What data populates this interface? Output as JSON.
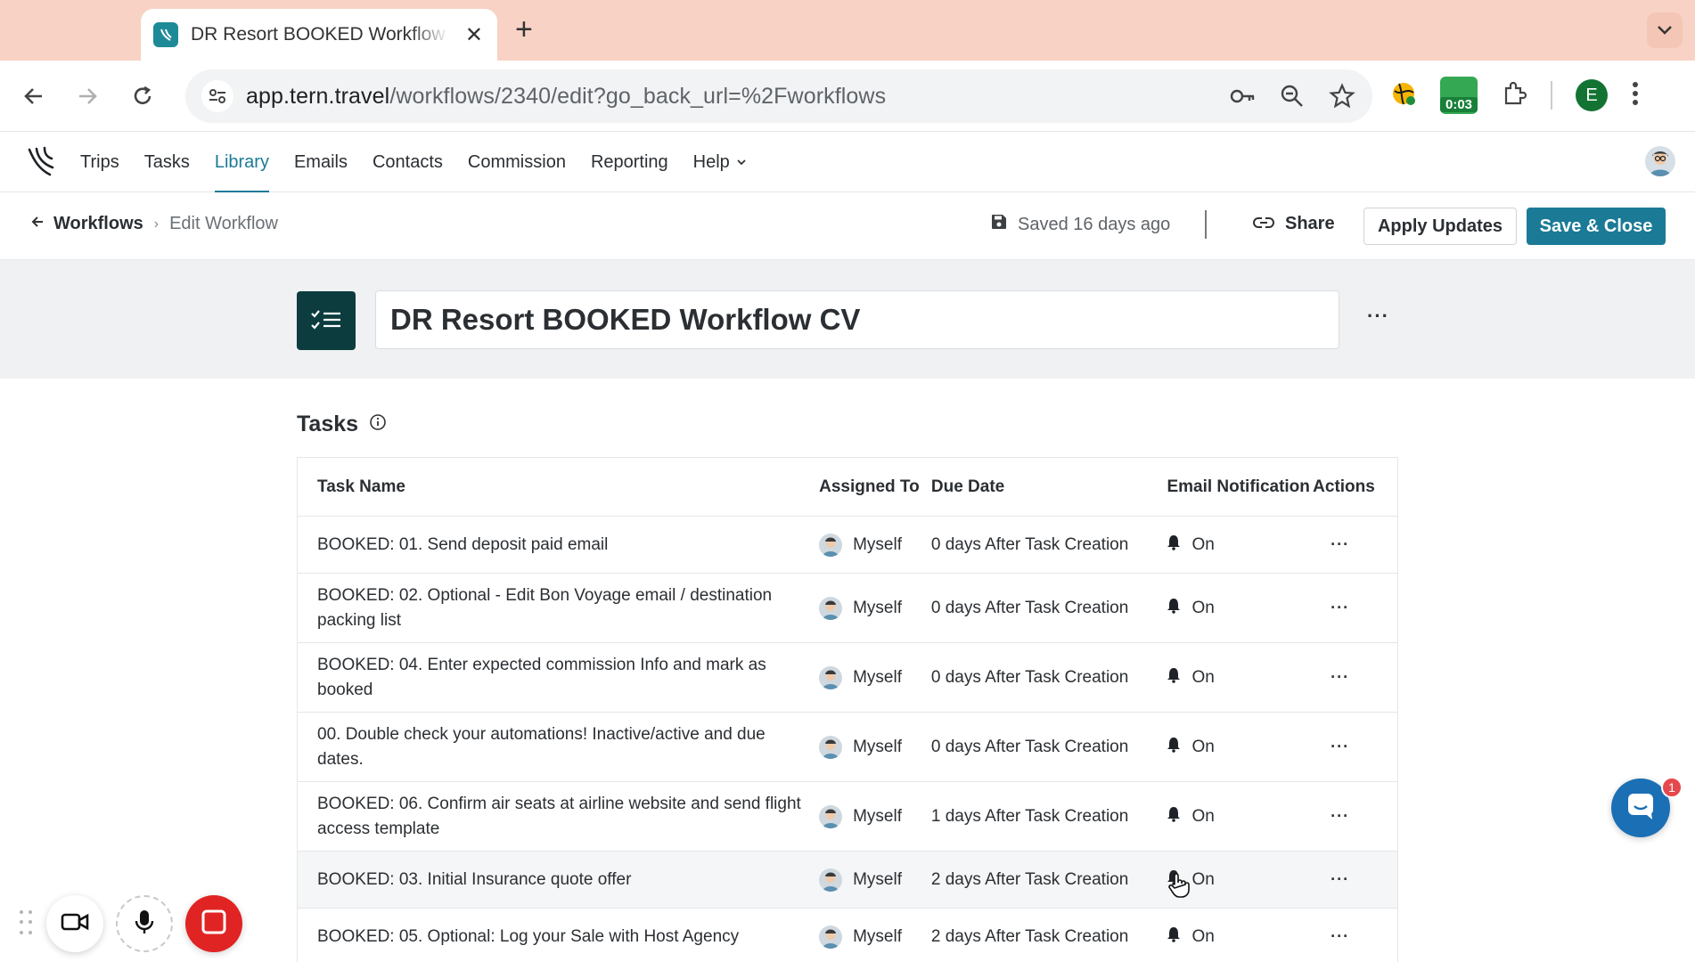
{
  "browser": {
    "tab_title": "DR Resort BOOKED Workflow CV",
    "url_host": "app.tern.travel",
    "url_path": "/workflows/2340/edit?go_back_url=%2Fworkflows",
    "extension_timer": "0:03",
    "profile_initial": "E"
  },
  "nav": {
    "items": [
      {
        "label": "Trips"
      },
      {
        "label": "Tasks"
      },
      {
        "label": "Library"
      },
      {
        "label": "Emails"
      },
      {
        "label": "Contacts"
      },
      {
        "label": "Commission"
      },
      {
        "label": "Reporting"
      },
      {
        "label": "Help"
      }
    ],
    "active": "Library"
  },
  "subheader": {
    "breadcrumb_root": "Workflows",
    "breadcrumb_current": "Edit Workflow",
    "saved_status": "Saved 16 days ago",
    "share_label": "Share",
    "apply_label": "Apply Updates",
    "save_close_label": "Save & Close"
  },
  "workflow": {
    "title": "DR Resort BOOKED Workflow CV"
  },
  "tasks": {
    "heading": "Tasks",
    "columns": {
      "name": "Task Name",
      "assigned": "Assigned To",
      "due": "Due Date",
      "email": "Email Notification",
      "actions": "Actions"
    },
    "rows": [
      {
        "name": "BOOKED: 01. Send deposit paid email",
        "assignee": "Myself",
        "due": "0 days After Task Creation",
        "notification": "On"
      },
      {
        "name": "BOOKED: 02. Optional - Edit Bon Voyage email / destination packing list",
        "assignee": "Myself",
        "due": "0 days After Task Creation",
        "notification": "On"
      },
      {
        "name": "BOOKED: 04. Enter expected commission Info and mark as booked",
        "assignee": "Myself",
        "due": "0 days After Task Creation",
        "notification": "On"
      },
      {
        "name": "00. Double check your automations! Inactive/active and due dates.",
        "assignee": "Myself",
        "due": "0 days After Task Creation",
        "notification": "On"
      },
      {
        "name": "BOOKED: 06. Confirm air seats at airline website and send flight access template",
        "assignee": "Myself",
        "due": "1 days After Task Creation",
        "notification": "On"
      },
      {
        "name": "BOOKED: 03. Initial Insurance quote offer",
        "assignee": "Myself",
        "due": "2 days After Task Creation",
        "notification": "On"
      },
      {
        "name": "BOOKED: 05. Optional: Log your Sale with Host Agency",
        "assignee": "Myself",
        "due": "2 days After Task Creation",
        "notification": "On"
      }
    ]
  },
  "chat": {
    "badge_count": "1"
  },
  "colors": {
    "accent": "#1b7a96",
    "tab_bar": "#f8d2c4",
    "workflow_icon_bg": "#0c3c3e"
  }
}
